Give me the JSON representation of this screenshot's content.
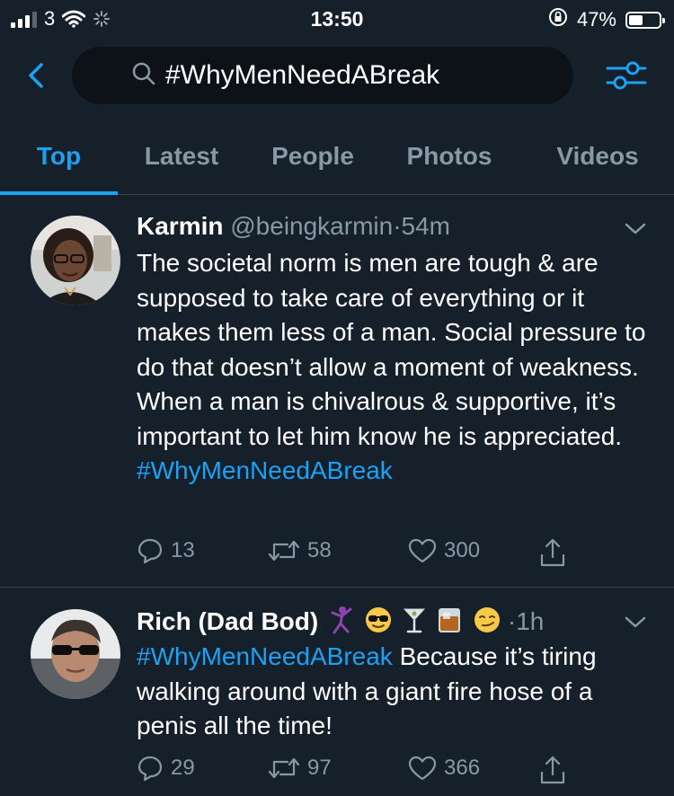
{
  "status_bar": {
    "carrier": "3",
    "time": "13:50",
    "battery": "47%",
    "battery_level": 0.47
  },
  "search": {
    "query": "#WhyMenNeedABreak",
    "back_icon": "chevron-left-icon",
    "search_icon": "search-icon",
    "filter_icon": "filter-sliders-icon"
  },
  "tabs": [
    {
      "label": "Top",
      "active": true
    },
    {
      "label": "Latest",
      "active": false
    },
    {
      "label": "People",
      "active": false
    },
    {
      "label": "Photos",
      "active": false
    },
    {
      "label": "Videos",
      "active": false
    }
  ],
  "tweets": [
    {
      "name": "Karmin",
      "handle": "@beingkarmin",
      "sep": "·",
      "time": "54m",
      "text": "The societal norm is men are tough & are supposed to take care of everything or it makes them less of a man. Social pressure to do that doesn’t allow a moment of weakness. When a man is chivalrous & supportive, it’s important to let him know he is appreciated.",
      "hashtag": "#WhyMenNeedABreak",
      "replies": "13",
      "retweets": "58",
      "likes": "300"
    },
    {
      "name": "Rich (Dad Bod)",
      "emojis": [
        "dancer-emoji",
        "sunglasses-emoji",
        "cocktail-emoji",
        "whiskey-emoji",
        "smirk-emoji"
      ],
      "sep": "·",
      "time": "1h",
      "hashtag": "#WhyMenNeedABreak",
      "text": " Because it’s tiring walking around with a giant fire hose of a penis all the time!",
      "replies": "29",
      "retweets": "97",
      "likes": "366"
    }
  ],
  "colors": {
    "background": "#15202b",
    "accent": "#1da1f2",
    "muted": "#8899a6",
    "divider": "#38444d"
  }
}
